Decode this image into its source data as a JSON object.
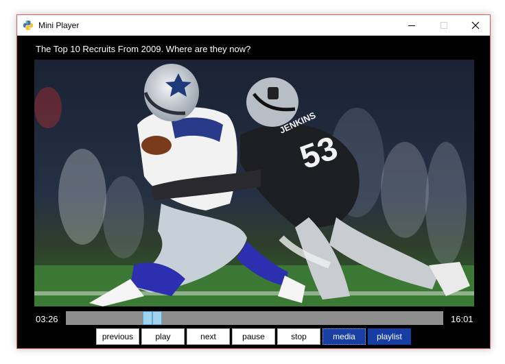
{
  "window": {
    "title": "Mini Player",
    "icon": "python-icon"
  },
  "player": {
    "video_title": "The Top 10 Recruits From 2009. Where are they now?",
    "elapsed": "03:26",
    "duration": "16:01",
    "progress": 0.214,
    "jersey_name": "JENKINS",
    "jersey_number": "53"
  },
  "controls": {
    "previous": "previous",
    "play": "play",
    "next": "next",
    "pause": "pause",
    "stop": "stop",
    "media": "media",
    "playlist": "playlist"
  },
  "colors": {
    "accent": "#163da4",
    "seek_handle": "#9fd3ee"
  }
}
